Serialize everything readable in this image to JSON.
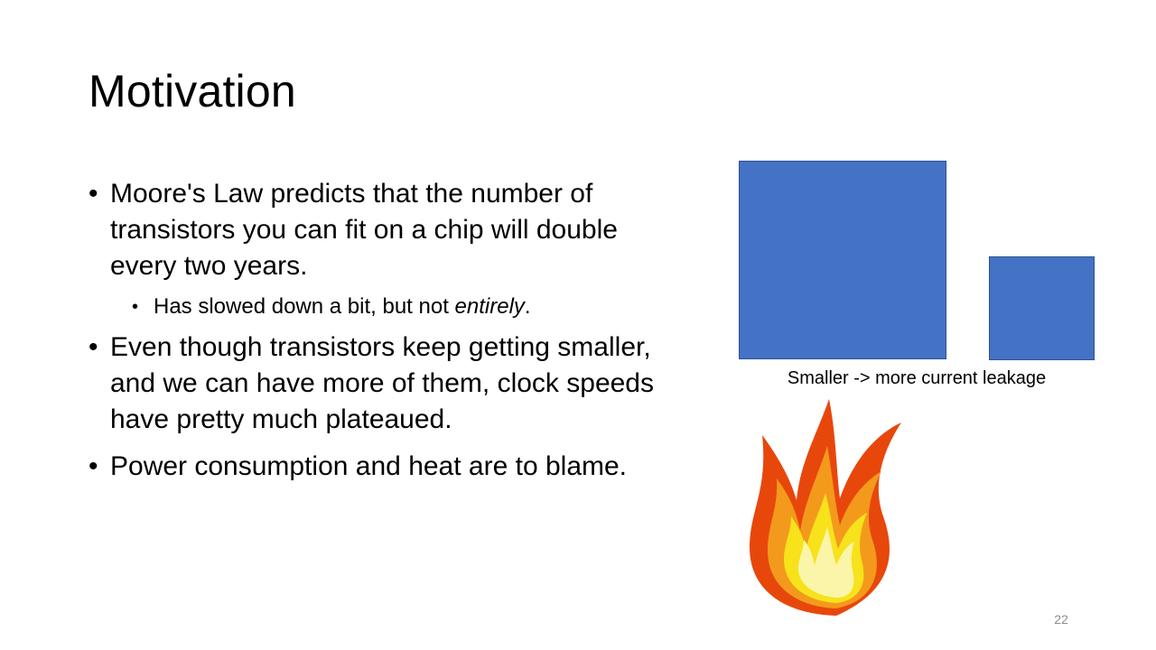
{
  "slide": {
    "title": "Motivation",
    "bullets": [
      {
        "text": "Moore's Law predicts that the number of transistors you can fit on a chip will double every two years.",
        "sub": {
          "prefix": "Has slowed down a bit, but not ",
          "emphasis": "entirely",
          "suffix": "."
        }
      },
      {
        "text": "Even though transistors keep getting smaller, and we can have more of them, clock speeds have pretty much plateaued."
      },
      {
        "text": "Power consumption and heat are to blame."
      }
    ],
    "bullet_glyph": "•",
    "caption": "Smaller -> more current leakage",
    "page_number": "22"
  },
  "colors": {
    "box_fill": "#4472c4",
    "flame_outer": "#e8470c",
    "flame_mid": "#f39a1c",
    "flame_inner": "#f7e21b",
    "flame_core": "#faf5a8",
    "page_number": "#8c8c8c"
  },
  "icons": {
    "flame": "fire-icon"
  }
}
